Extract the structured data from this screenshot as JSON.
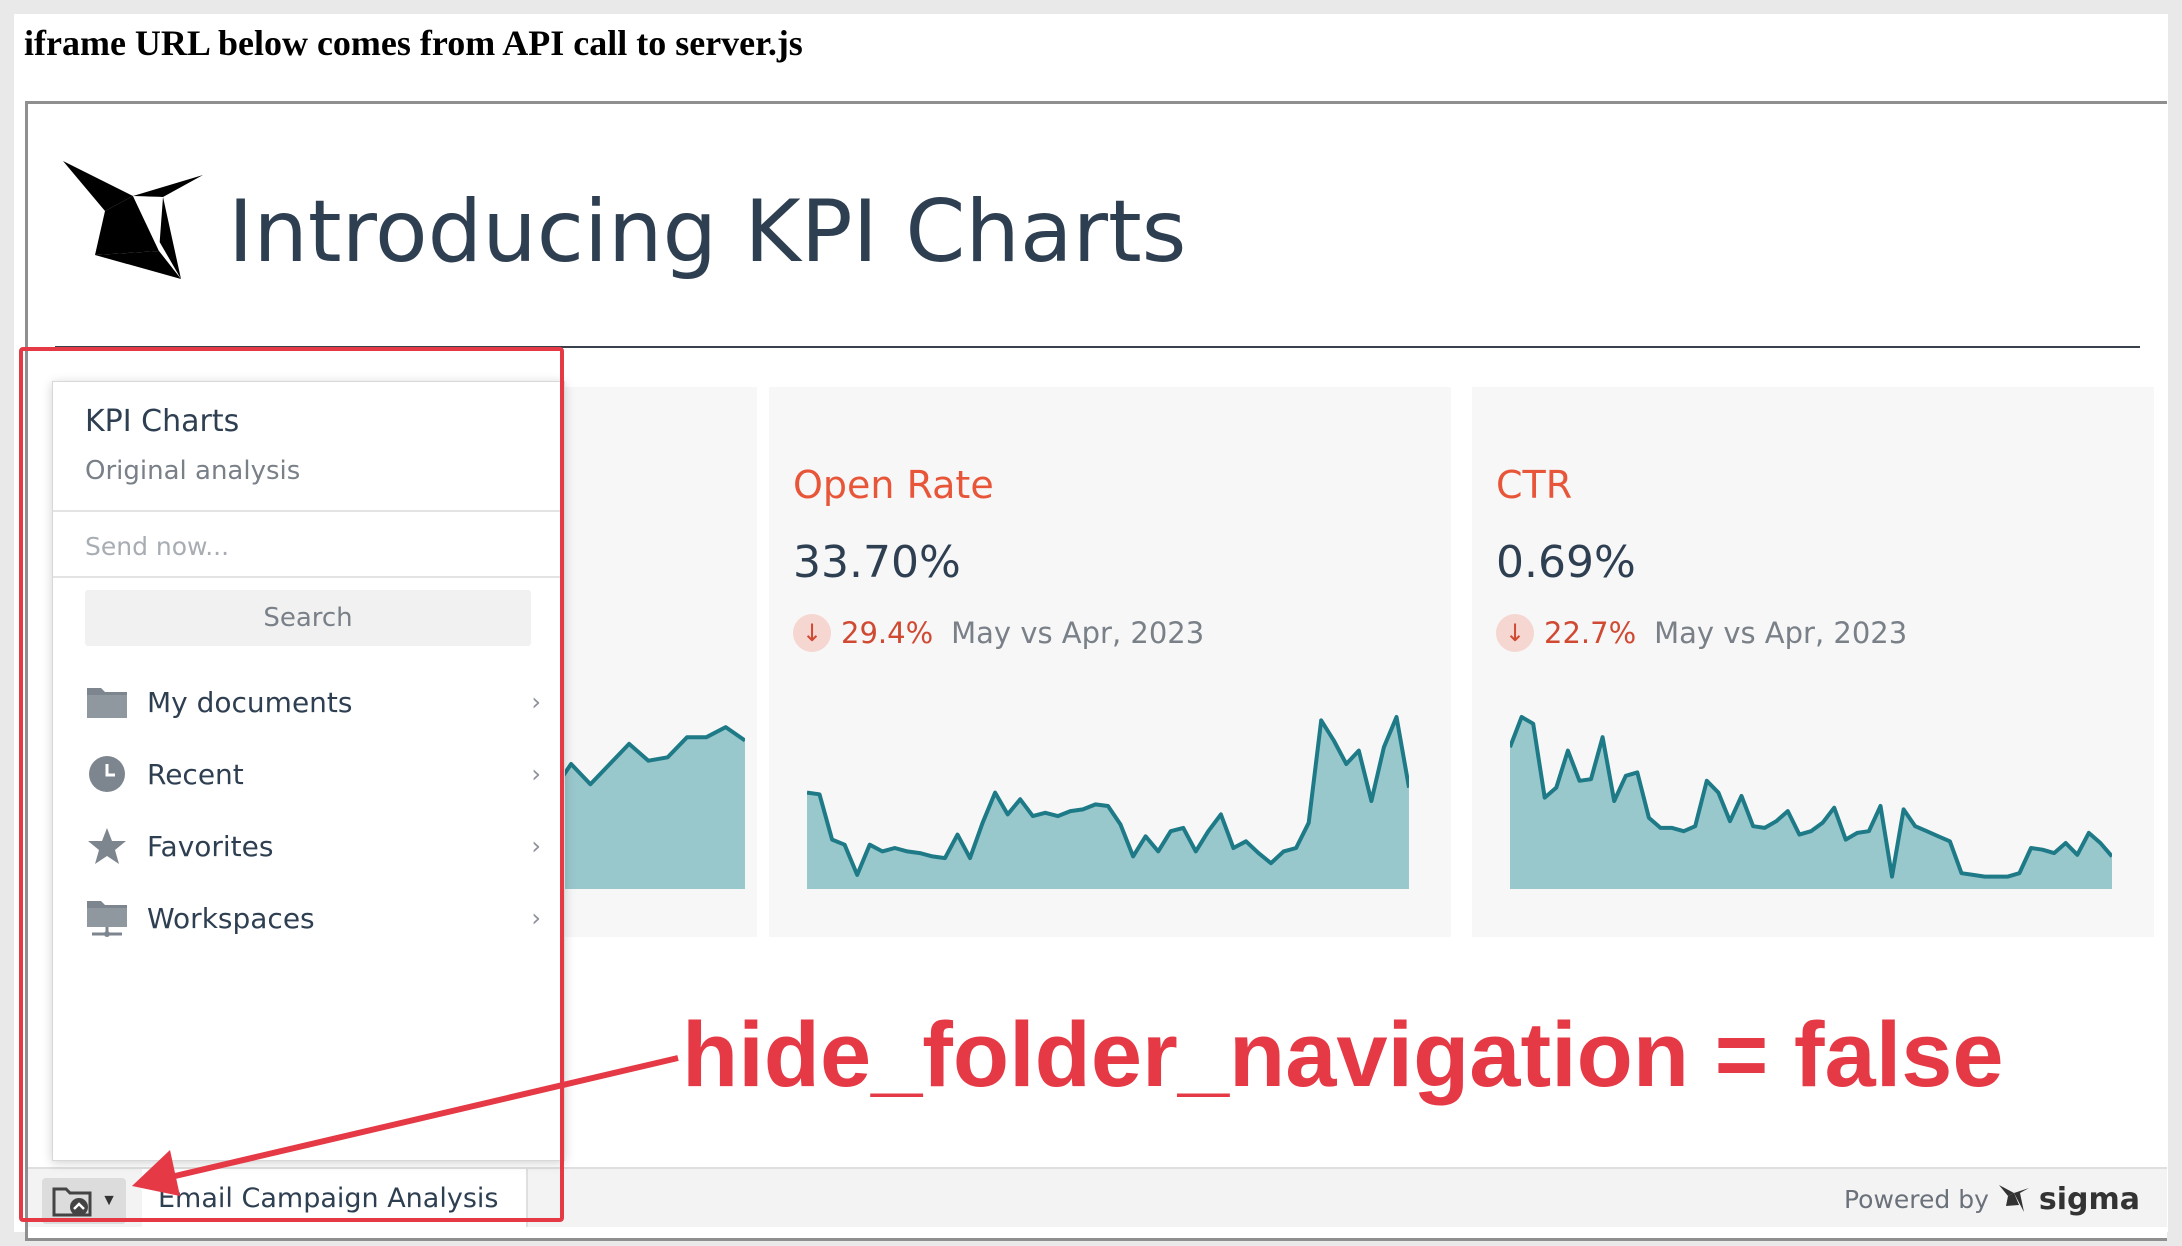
{
  "page": {
    "heading": "iframe URL below comes from API call to server.js"
  },
  "embed": {
    "title": "Introducing KPI Charts",
    "cards": [
      {
        "title": "Open Rate",
        "value": "33.70%",
        "delta": "29.4%",
        "period": "May vs Apr, 2023",
        "trend_icon": "arrow-down-icon",
        "series": [
          0.55,
          0.54,
          0.27,
          0.24,
          0.06,
          0.24,
          0.2,
          0.22,
          0.2,
          0.19,
          0.17,
          0.16,
          0.3,
          0.16,
          0.37,
          0.55,
          0.42,
          0.51,
          0.41,
          0.43,
          0.41,
          0.44,
          0.45,
          0.48,
          0.47,
          0.36,
          0.17,
          0.29,
          0.2,
          0.32,
          0.34,
          0.2,
          0.32,
          0.42,
          0.22,
          0.26,
          0.19,
          0.13,
          0.2,
          0.22,
          0.37,
          0.98,
          0.86,
          0.72,
          0.8,
          0.5,
          0.82,
          1.0,
          0.58
        ]
      },
      {
        "title": "CTR",
        "value": "0.69%",
        "delta": "22.7%",
        "period": "May vs Apr, 2023",
        "trend_icon": "arrow-down-icon",
        "series": [
          0.82,
          1.0,
          0.96,
          0.52,
          0.58,
          0.8,
          0.62,
          0.63,
          0.88,
          0.5,
          0.65,
          0.67,
          0.4,
          0.34,
          0.34,
          0.32,
          0.35,
          0.62,
          0.55,
          0.38,
          0.53,
          0.35,
          0.34,
          0.38,
          0.44,
          0.3,
          0.32,
          0.37,
          0.46,
          0.27,
          0.31,
          0.32,
          0.47,
          0.05,
          0.45,
          0.35,
          0.32,
          0.29,
          0.26,
          0.07,
          0.06,
          0.05,
          0.05,
          0.05,
          0.07,
          0.22,
          0.21,
          0.19,
          0.25,
          0.18,
          0.31,
          0.25,
          0.17
        ]
      }
    ],
    "hidden_card": {
      "series_tail": [
        0.55,
        0.72,
        0.6,
        0.72,
        0.84,
        0.74,
        0.76,
        0.88,
        0.88,
        0.94,
        0.86
      ]
    },
    "bottom_bar": {
      "tab": "Email Campaign Analysis",
      "powered_by": "Powered by",
      "brand": "sigma"
    },
    "nav_panel": {
      "title": "KPI Charts",
      "subtitle": "Original analysis",
      "send_placeholder": "Send now...",
      "search_label": "Search",
      "items": [
        {
          "label": "My documents",
          "icon": "folder-icon"
        },
        {
          "label": "Recent",
          "icon": "clock-icon"
        },
        {
          "label": "Favorites",
          "icon": "star-icon"
        },
        {
          "label": "Workspaces",
          "icon": "workspace-folder-icon"
        }
      ]
    }
  },
  "annotation": {
    "text": "hide_folder_navigation = false"
  },
  "colors": {
    "accent_red": "#e53946",
    "kpi_title": "#e8563a",
    "delta_red": "#d04a33",
    "spark_line": "#1d7a86",
    "spark_fill": "#98c7cc",
    "ink": "#2f3f52"
  }
}
